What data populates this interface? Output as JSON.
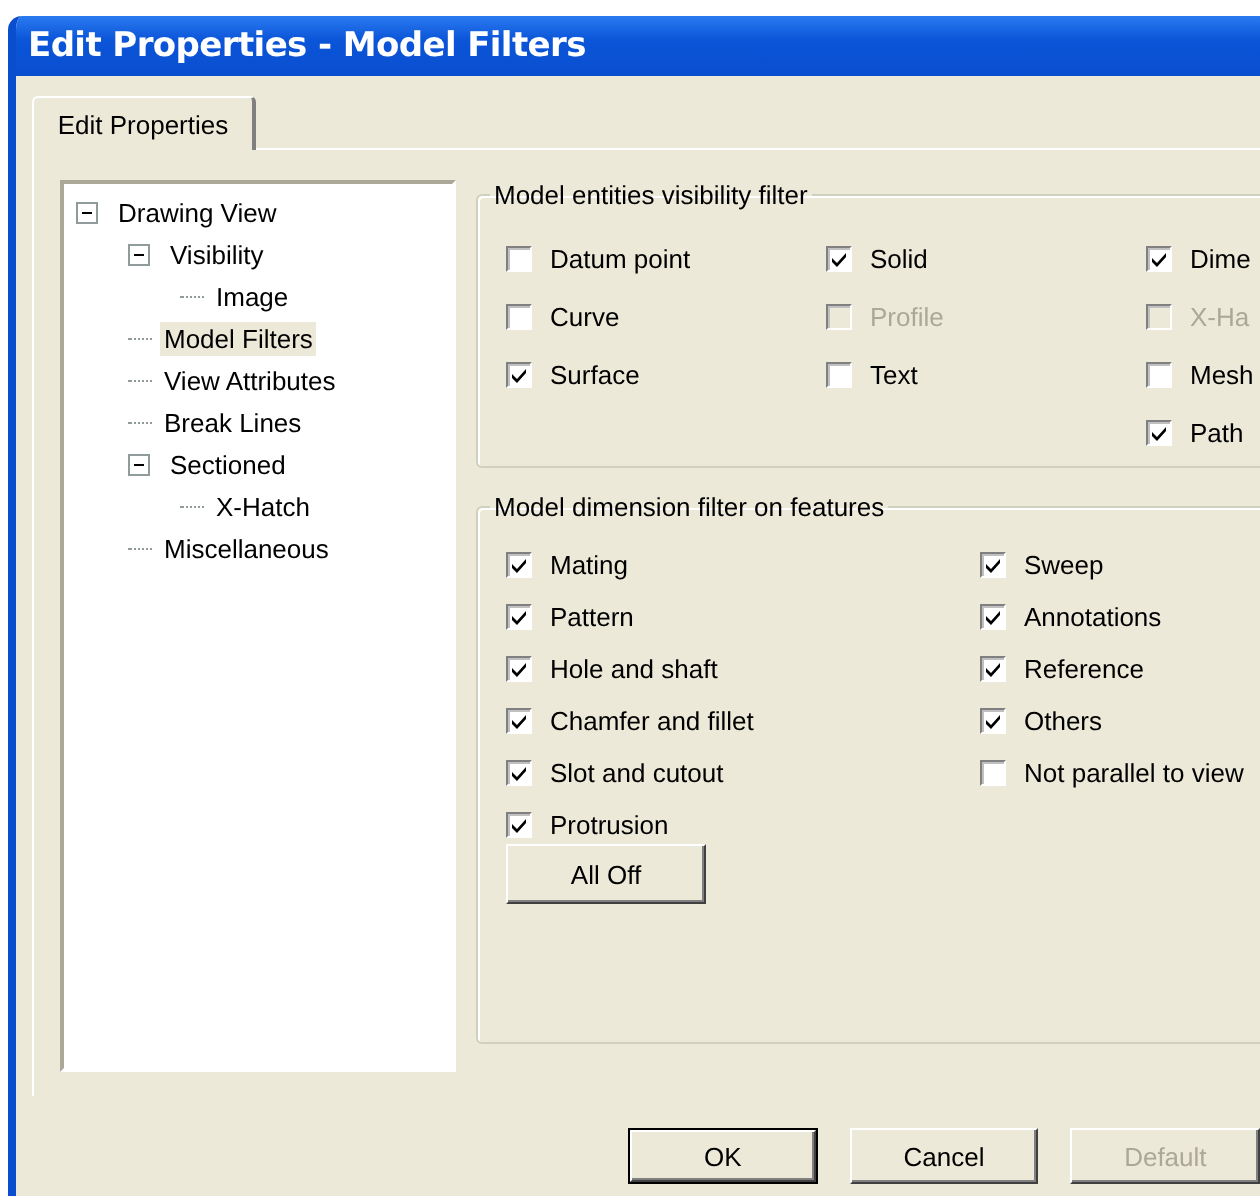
{
  "window": {
    "title": "Edit Properties - Model Filters"
  },
  "tabs": [
    {
      "label": "Edit Properties",
      "selected": true
    }
  ],
  "tree": [
    {
      "label": "Drawing View",
      "selected": false,
      "expanded": true,
      "children": [
        {
          "label": "Visibility",
          "selected": false,
          "expanded": true,
          "children": [
            {
              "label": "Image",
              "selected": false
            }
          ]
        },
        {
          "label": "Model Filters",
          "selected": true
        },
        {
          "label": "View Attributes",
          "selected": false
        },
        {
          "label": "Break Lines",
          "selected": false
        },
        {
          "label": "Sectioned",
          "selected": false,
          "expanded": true,
          "children": [
            {
              "label": "X-Hatch",
              "selected": false
            }
          ]
        },
        {
          "label": "Miscellaneous",
          "selected": false
        }
      ]
    }
  ],
  "visibility_filter": {
    "title": "Model entities visibility filter",
    "columns": [
      [
        {
          "label": "Datum point",
          "checked": false,
          "disabled": false
        },
        {
          "label": "Curve",
          "checked": false,
          "disabled": false
        },
        {
          "label": "Surface",
          "checked": true,
          "disabled": false
        }
      ],
      [
        {
          "label": "Solid",
          "checked": true,
          "disabled": false
        },
        {
          "label": "Profile",
          "checked": false,
          "disabled": true
        },
        {
          "label": "Text",
          "checked": false,
          "disabled": false
        }
      ],
      [
        {
          "label": "Dime",
          "checked": true,
          "disabled": false
        },
        {
          "label": "X-Ha",
          "checked": false,
          "disabled": true
        },
        {
          "label": "Mesh",
          "checked": false,
          "disabled": false
        },
        {
          "label": "Path",
          "checked": true,
          "disabled": false
        }
      ]
    ]
  },
  "dimension_filter": {
    "title": "Model dimension filter on features",
    "columns": [
      [
        {
          "label": "Mating",
          "checked": true,
          "disabled": false
        },
        {
          "label": "Pattern",
          "checked": true,
          "disabled": false
        },
        {
          "label": "Hole and shaft",
          "checked": true,
          "disabled": false
        },
        {
          "label": "Chamfer and fillet",
          "checked": true,
          "disabled": false
        },
        {
          "label": "Slot and cutout",
          "checked": true,
          "disabled": false
        },
        {
          "label": "Protrusion",
          "checked": true,
          "disabled": false
        }
      ],
      [
        {
          "label": "Sweep",
          "checked": true,
          "disabled": false
        },
        {
          "label": "Annotations",
          "checked": true,
          "disabled": false
        },
        {
          "label": "Reference",
          "checked": true,
          "disabled": false
        },
        {
          "label": "Others",
          "checked": true,
          "disabled": false
        },
        {
          "label": "Not parallel to view",
          "checked": false,
          "disabled": false
        }
      ]
    ],
    "button": "All Off"
  },
  "buttons": [
    {
      "label": "OK",
      "default": true,
      "disabled": false
    },
    {
      "label": "Cancel",
      "default": false,
      "disabled": false
    },
    {
      "label": "Default",
      "default": false,
      "disabled": true
    }
  ]
}
